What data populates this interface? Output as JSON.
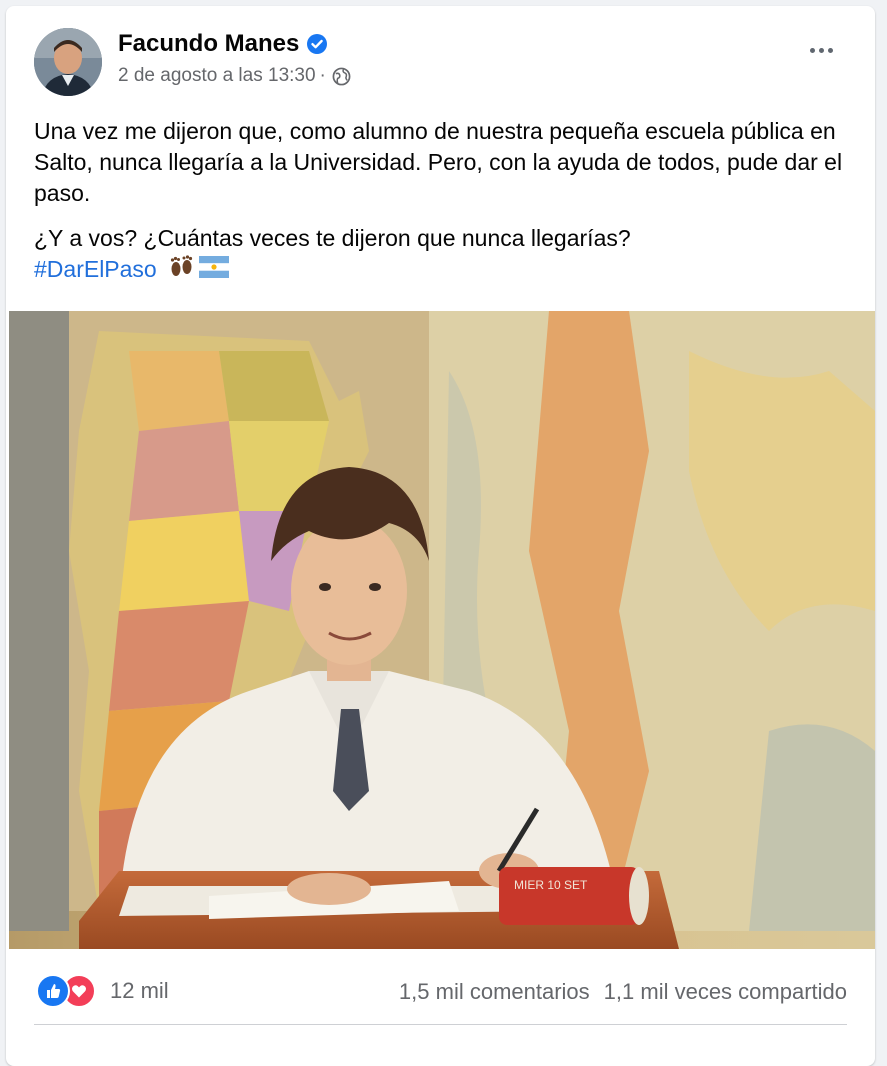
{
  "post": {
    "author": "Facundo Manes",
    "timestamp": "2 de agosto a las 13:30",
    "separator": "·",
    "privacy_icon": "globe-icon",
    "verified_icon": "verified-badge-icon",
    "more_icon": "more-options-icon",
    "paragraphs": [
      "Una vez me dijeron que, como alumno de nuestra pequeña escuela pública en Salto, nunca llegaría a la Universidad. Pero, con la ayuda de todos, pude dar el paso.",
      "¿Y a vos? ¿Cuántas veces te dijeron que nunca llegarías?"
    ],
    "hashtag": "#DarElPaso",
    "emojis": [
      "footprints-emoji",
      "argentina-flag-emoji"
    ],
    "photo_label": "MIER 10 SET"
  },
  "stats": {
    "reaction_icons": [
      "like-icon",
      "love-icon"
    ],
    "reactions_count": "12 mil",
    "comments": "1,5 mil comentarios",
    "shares": "1,1 mil veces compartido"
  },
  "colors": {
    "link": "#216fdb",
    "like": "#1877f2",
    "love": "#f33e58",
    "secondary_text": "#65676b"
  }
}
